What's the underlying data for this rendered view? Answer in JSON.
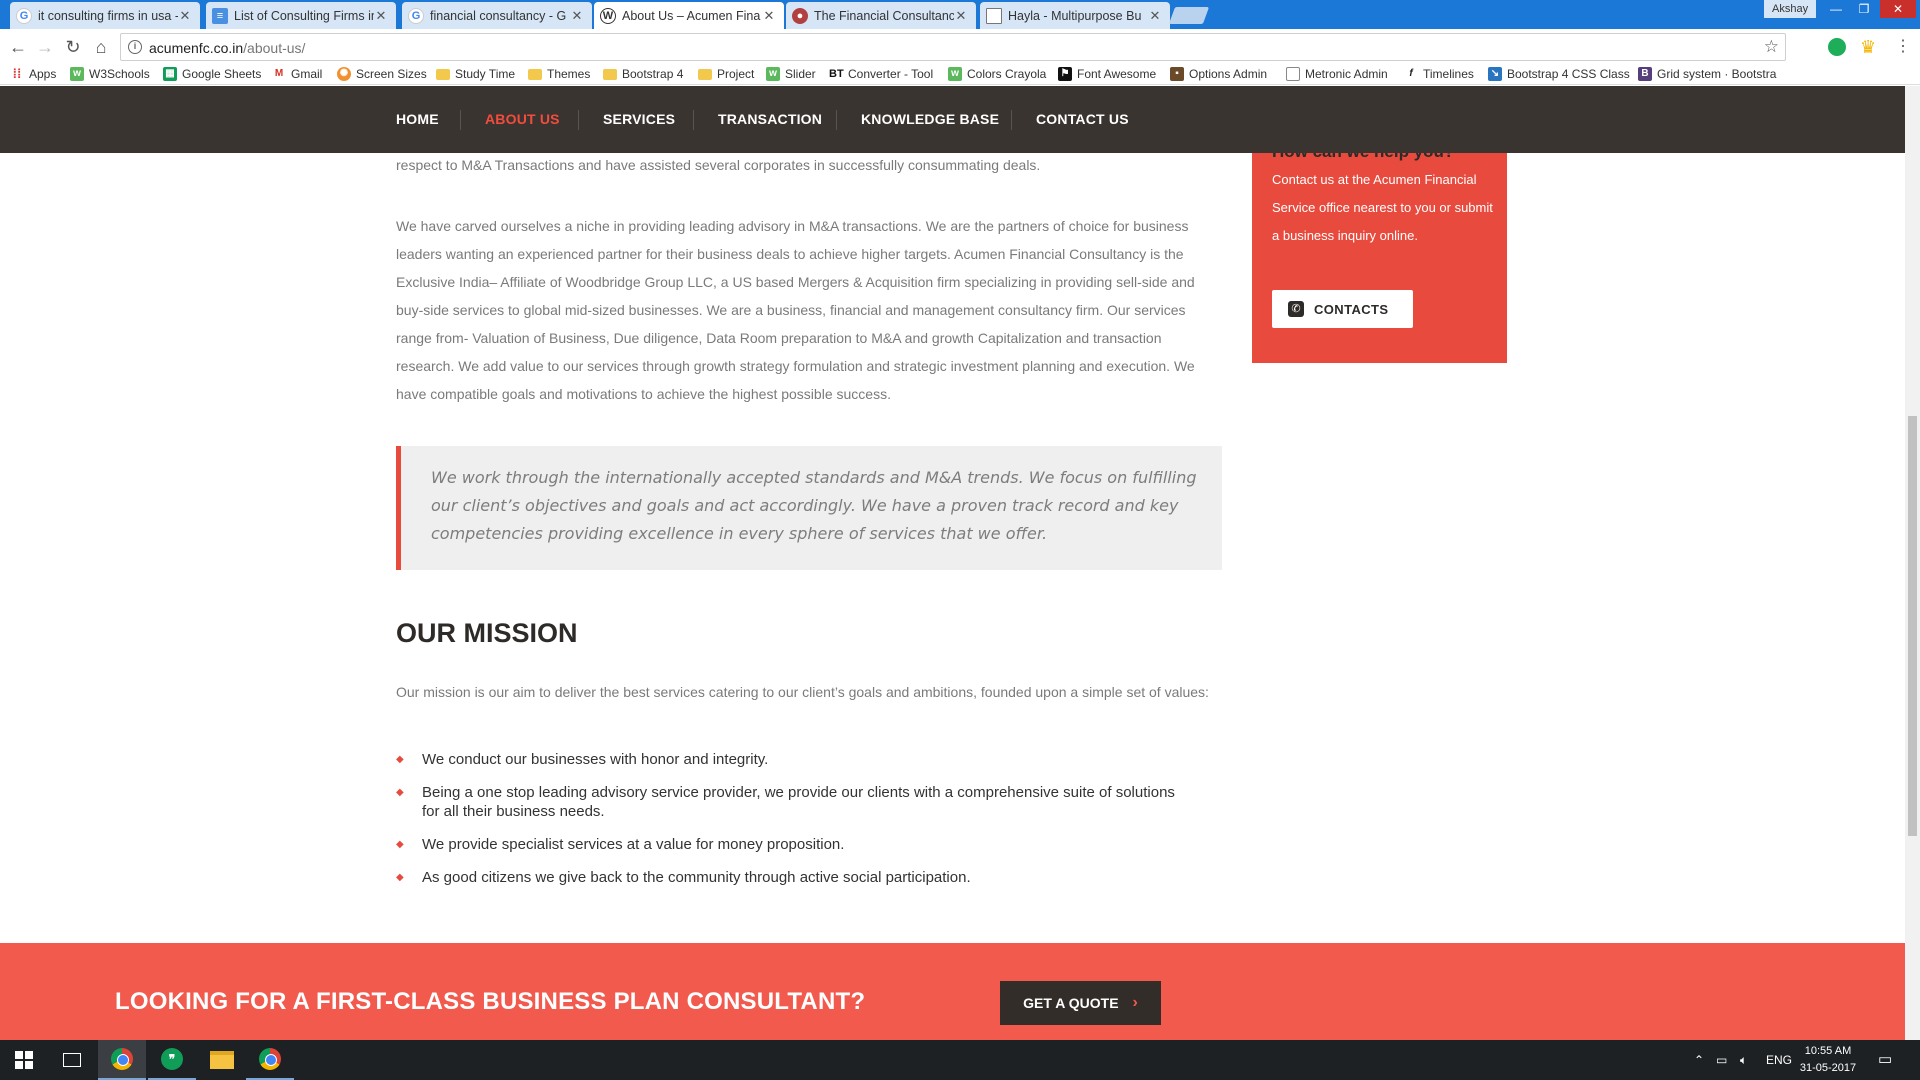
{
  "browser": {
    "tabs": [
      {
        "title": "it consulting firms in usa -",
        "favicon": "google-icon"
      },
      {
        "title": "List of Consulting Firms in",
        "favicon": "document-icon"
      },
      {
        "title": "financial consultancy - G",
        "favicon": "google-icon"
      },
      {
        "title": "About Us – Acumen Fina",
        "favicon": "wordpress-icon",
        "active": true
      },
      {
        "title": "The Financial Consultanc",
        "favicon": "site-icon"
      },
      {
        "title": "Hayla - Multipurpose Bu",
        "favicon": "page-icon"
      }
    ],
    "profile_name": "Akshay",
    "address": {
      "host": "acumenfc.co.in",
      "path": "/about-us/"
    },
    "bookmarks": [
      {
        "label": "Apps",
        "icon": "apps-grid-icon"
      },
      {
        "label": "W3Schools",
        "icon": "w3schools-icon"
      },
      {
        "label": "Google Sheets",
        "icon": "sheets-icon"
      },
      {
        "label": "Gmail",
        "icon": "gmail-icon"
      },
      {
        "label": "Screen Sizes",
        "icon": "screen-sizes-icon"
      },
      {
        "label": "Study Time",
        "icon": "folder-icon"
      },
      {
        "label": "Themes",
        "icon": "folder-icon"
      },
      {
        "label": "Bootstrap 4",
        "icon": "folder-icon"
      },
      {
        "label": "Project",
        "icon": "folder-icon"
      },
      {
        "label": "Slider",
        "icon": "w3schools-icon"
      },
      {
        "label": "Converter - Tool",
        "icon": "bt-icon"
      },
      {
        "label": "Colors Crayola",
        "icon": "w3schools-icon"
      },
      {
        "label": "Font Awesome",
        "icon": "font-awesome-icon"
      },
      {
        "label": "Options Admin",
        "icon": "options-icon"
      },
      {
        "label": "Metronic Admin",
        "icon": "page-icon"
      },
      {
        "label": "Timelines",
        "icon": "timelines-icon"
      },
      {
        "label": "Bootstrap 4 CSS Class",
        "icon": "bootstrap-bird-icon"
      },
      {
        "label": "Grid system · Bootstra",
        "icon": "bootstrap-icon"
      }
    ]
  },
  "site": {
    "nav": [
      {
        "label": "HOME"
      },
      {
        "label": "ABOUT US",
        "active": true
      },
      {
        "label": "SERVICES"
      },
      {
        "label": "TRANSACTION"
      },
      {
        "label": "KNOWLEDGE BASE"
      },
      {
        "label": "CONTACT US"
      }
    ],
    "intro_tail": "respect to M&A Transactions and have assisted several corporates in successfully consummating deals.",
    "about_paragraph": "We have carved ourselves a niche in providing leading advisory in M&A transactions. We are the partners of choice for business leaders wanting an experienced partner for their business deals to achieve higher targets. Acumen Financial Consultancy is the Exclusive India– Affiliate of Woodbridge Group LLC, a US based Mergers & Acquisition firm specializing in providing sell-side and buy-side services to global mid-sized businesses. We are a business, financial and management consultancy firm. Our services range from- Valuation of Business, Due diligence, Data Room preparation to M&A and growth Capitalization and transaction research. We add value to our services through growth strategy formulation and strategic investment planning and execution.  We have compatible goals and motivations to achieve the highest possible success.",
    "blockquote": "We work through the internationally accepted standards and M&A trends. We focus on fulfilling our client’s objectives and goals and act accordingly. We have a proven track record and key competencies providing excellence in every sphere of services that we offer.",
    "mission": {
      "title": "OUR MISSION",
      "intro": "Our mission is our aim to deliver the best services catering to our client’s goals and ambitions, founded upon a simple set of values:",
      "items": [
        "We conduct our businesses with honor and integrity.",
        "Being a one stop leading advisory service provider, we provide our clients with a comprehensive suite of solutions for all their business needs.",
        "We provide specialist services at a value for money proposition.",
        "As good citizens we give back to the community through active social participation."
      ]
    },
    "help_box": {
      "title": "How can we help you?",
      "text": "Contact us at the Acumen Financial Service office nearest to you or submit a business inquiry online.",
      "button": "CONTACTS"
    },
    "cta": {
      "title": "LOOKING FOR A FIRST-CLASS BUSINESS PLAN CONSULTANT?",
      "button": "GET A QUOTE"
    }
  },
  "taskbar": {
    "language": "ENG",
    "time": "10:55 AM",
    "date": "31-05-2017"
  },
  "colors": {
    "accent": "#e84a3d",
    "nav_bg": "#3a3431",
    "cta_bg": "#f25a4e"
  }
}
